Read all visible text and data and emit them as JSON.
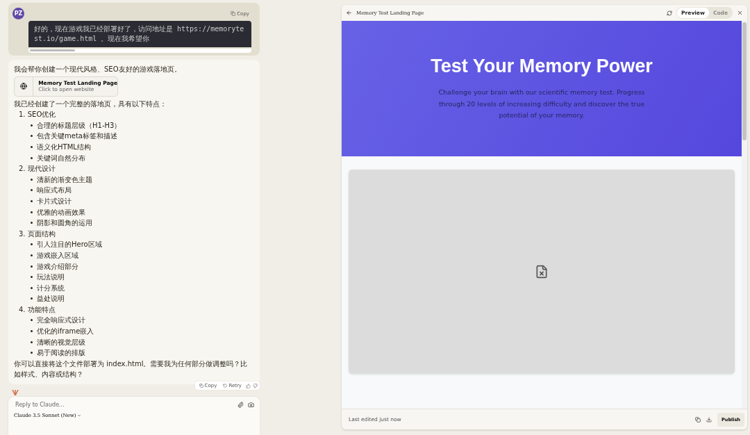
{
  "user_message": {
    "avatar": "PZ",
    "copy_label": "Copy",
    "code": "好的，现在游戏我已经部署好了，访问地址是 https://memorytest.io/game.html 。现在我希望你"
  },
  "assistant_message": {
    "intro": "我会帮你创建一个现代风格、SEO友好的游戏落地页。",
    "artifact": {
      "title": "Memory Test Landing Page",
      "subtitle": "Click to open website"
    },
    "lead": "我已经创建了一个完整的落地页，具有以下特点：",
    "sections": [
      {
        "number": "1.",
        "title": "SEO优化",
        "items": [
          "合理的标题层级（H1-H3）",
          "包含关键meta标签和描述",
          "语义化HTML结构",
          "关键词自然分布"
        ]
      },
      {
        "number": "2.",
        "title": "现代设计",
        "items": [
          "清新的渐变色主题",
          "响应式布局",
          "卡片式设计",
          "优雅的动画效果",
          "阴影和圆角的运用"
        ]
      },
      {
        "number": "3.",
        "title": "页面结构",
        "items": [
          "引人注目的Hero区域",
          "游戏嵌入区域",
          "游戏介绍部分",
          "玩法说明",
          "计分系统",
          "益处说明"
        ]
      },
      {
        "number": "4.",
        "title": "功能特点",
        "items": [
          "完全响应式设计",
          "优化的iframe嵌入",
          "清晰的视觉层级",
          "易于阅读的排版"
        ]
      }
    ],
    "closing": "你可以直接将这个文件部署为 index.html。需要我为任何部分做调整吗？比如样式、内容或结构？",
    "actions": [
      "Copy",
      "Retry"
    ]
  },
  "composer": {
    "placeholder": "Reply to Claude...",
    "model": "Claude 3.5 Sonnet (New)"
  },
  "preview_panel": {
    "title": "Memory Test Landing Page",
    "tabs": [
      {
        "label": "Preview",
        "selected": true
      },
      {
        "label": "Code",
        "selected": false
      }
    ],
    "hero": {
      "heading": "Test Your Memory Power",
      "text": "Challenge your brain with our scientific memory test. Progress through 20 levels of increasing difficulty and discover the true potential of your memory."
    },
    "footer": {
      "status": "Last edited just now",
      "publish": "Publish"
    }
  }
}
